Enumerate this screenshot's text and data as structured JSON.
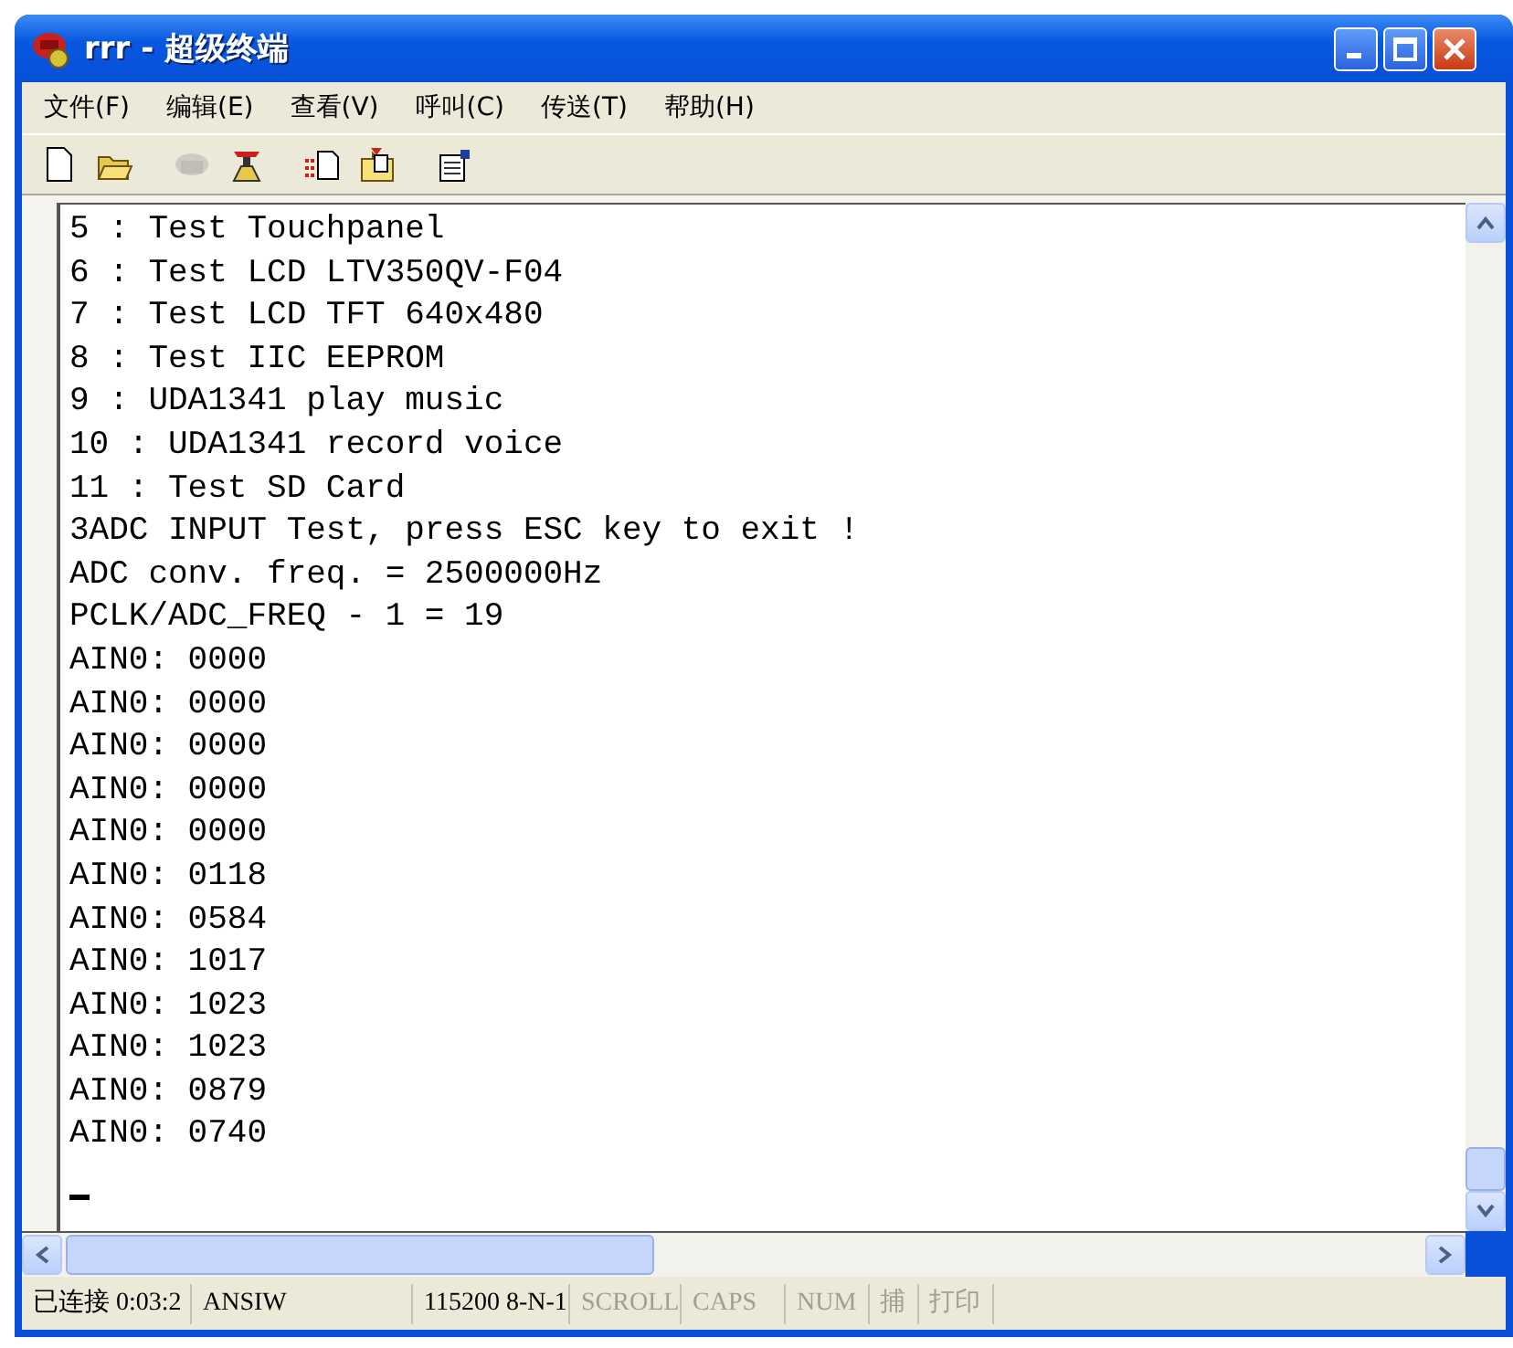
{
  "window": {
    "title": "rrr - 超级终端"
  },
  "menu": [
    {
      "label": "文件(F)"
    },
    {
      "label": "编辑(E)"
    },
    {
      "label": "查看(V)"
    },
    {
      "label": "呼叫(C)"
    },
    {
      "label": "传送(T)"
    },
    {
      "label": "帮助(H)"
    }
  ],
  "toolbar": [
    {
      "kind": "new",
      "disabled": false
    },
    {
      "kind": "open",
      "disabled": false
    },
    {
      "kind": "call",
      "disabled": true
    },
    {
      "kind": "hangup",
      "disabled": false
    },
    {
      "kind": "send",
      "disabled": false
    },
    {
      "kind": "receive",
      "disabled": false
    },
    {
      "kind": "properties",
      "disabled": false
    }
  ],
  "terminal": {
    "lines": [
      "5 : Test Touchpanel",
      "6 : Test LCD LTV350QV-F04",
      "7 : Test LCD TFT 640x480",
      "8 : Test IIC EEPROM",
      "9 : UDA1341 play music",
      "10 : UDA1341 record voice",
      "11 : Test SD Card",
      "3ADC INPUT Test, press ESC key to exit !",
      "ADC conv. freq. = 2500000Hz",
      "PCLK/ADC_FREQ - 1 = 19",
      "AIN0: 0000",
      "AIN0: 0000",
      "AIN0: 0000",
      "AIN0: 0000",
      "AIN0: 0000",
      "AIN0: 0118",
      "AIN0: 0584",
      "AIN0: 1017",
      "AIN0: 1023",
      "AIN0: 1023",
      "AIN0: 0879",
      "AIN0: 0740"
    ]
  },
  "status_bar": [
    {
      "text": "已连接 0:03:2",
      "disabled": false
    },
    {
      "text": "ANSIW",
      "disabled": false
    },
    {
      "text": "115200 8-N-1",
      "disabled": false
    },
    {
      "text": "SCROLL",
      "disabled": true
    },
    {
      "text": "CAPS",
      "disabled": true
    },
    {
      "text": "NUM",
      "disabled": true
    },
    {
      "text": "捕",
      "disabled": true
    },
    {
      "text": "打印",
      "disabled": true
    }
  ]
}
